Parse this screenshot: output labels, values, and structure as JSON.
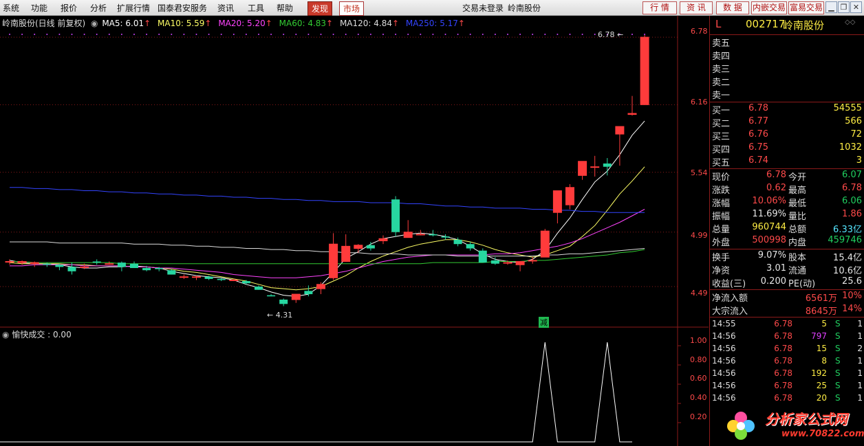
{
  "menubar": {
    "items": [
      "系统",
      "功能",
      "报价",
      "分析",
      "扩展行情",
      "国泰君安服务",
      "资讯",
      "工具",
      "帮助"
    ],
    "discover": "发现",
    "market": "市场",
    "status": "交易未登录",
    "stock_title": "岭南股份",
    "right_buttons": [
      "行 情",
      "资 讯",
      "数 据",
      "内嵌交易",
      "富易交易"
    ]
  },
  "chart_header": {
    "name": "岭南股份(日线 前复权)",
    "ma": [
      {
        "label": "MA5: 6.01",
        "color": "#ffffff"
      },
      {
        "label": "MA10: 5.59",
        "color": "#ffff66"
      },
      {
        "label": "MA20: 5.20",
        "color": "#ff44ff"
      },
      {
        "label": "MA60: 4.83",
        "color": "#33cc33"
      },
      {
        "label": "MA120: 4.84",
        "color": "#dddddd"
      },
      {
        "label": "MA250: 5.17",
        "color": "#3344ff"
      }
    ]
  },
  "price_axis": [
    "6.78",
    "6.16",
    "5.54",
    "4.99",
    "4.49"
  ],
  "annotations": {
    "high": "6.78",
    "low": "4.31",
    "marker": "减"
  },
  "indicator": {
    "title": "愉快成交 : 0.00",
    "axis": [
      "1.00",
      "0.80",
      "0.60",
      "0.40",
      "0.20"
    ]
  },
  "chart_data": {
    "type": "candlestick",
    "ylim": [
      4.25,
      6.85
    ],
    "candles": [
      [
        4.72,
        4.74,
        4.69,
        4.72
      ],
      [
        4.71,
        4.73,
        4.69,
        4.72
      ],
      [
        4.7,
        4.72,
        4.67,
        4.71
      ],
      [
        4.7,
        4.71,
        4.67,
        4.69
      ],
      [
        4.69,
        4.7,
        4.64,
        4.67
      ],
      [
        4.67,
        4.71,
        4.6,
        4.63
      ],
      [
        4.67,
        4.7,
        4.65,
        4.67
      ],
      [
        4.72,
        4.74,
        4.69,
        4.71
      ],
      [
        4.7,
        4.72,
        4.69,
        4.7
      ],
      [
        4.71,
        4.72,
        4.63,
        4.67
      ],
      [
        4.7,
        4.72,
        4.66,
        4.66
      ],
      [
        4.66,
        4.68,
        4.63,
        4.64
      ],
      [
        4.66,
        4.67,
        4.63,
        4.65
      ],
      [
        4.64,
        4.65,
        4.6,
        4.6
      ],
      [
        4.58,
        4.6,
        4.56,
        4.58
      ],
      [
        4.58,
        4.59,
        4.55,
        4.58
      ],
      [
        4.58,
        4.59,
        4.55,
        4.56
      ],
      [
        4.56,
        4.57,
        4.54,
        4.55
      ],
      [
        4.55,
        4.56,
        4.54,
        4.55
      ],
      [
        4.54,
        4.55,
        4.51,
        4.52
      ],
      [
        4.49,
        4.5,
        4.46,
        4.46
      ],
      [
        4.41,
        4.42,
        4.4,
        4.4
      ],
      [
        4.37,
        4.38,
        4.31,
        4.33
      ],
      [
        4.37,
        4.42,
        4.34,
        4.42
      ],
      [
        4.45,
        4.5,
        4.4,
        4.42
      ],
      [
        4.47,
        4.53,
        4.42,
        4.51
      ],
      [
        4.57,
        4.98,
        4.55,
        4.88
      ],
      [
        4.72,
        4.97,
        4.72,
        4.86
      ],
      [
        4.84,
        4.88,
        4.8,
        4.87
      ],
      [
        4.87,
        4.9,
        4.82,
        4.84
      ],
      [
        4.91,
        4.96,
        4.88,
        4.93
      ],
      [
        5.29,
        5.32,
        4.95,
        4.99
      ],
      [
        4.94,
        5.1,
        4.94,
        4.99
      ],
      [
        4.97,
        5.01,
        4.96,
        4.97
      ],
      [
        4.97,
        5.01,
        4.95,
        4.96
      ],
      [
        4.95,
        4.97,
        4.92,
        4.94
      ],
      [
        4.92,
        4.94,
        4.86,
        4.88
      ],
      [
        4.88,
        4.9,
        4.82,
        4.84
      ],
      [
        4.82,
        4.84,
        4.72,
        4.71
      ],
      [
        4.73,
        4.76,
        4.69,
        4.7
      ],
      [
        4.71,
        4.73,
        4.69,
        4.71
      ],
      [
        4.69,
        4.72,
        4.63,
        4.72
      ],
      [
        4.73,
        4.76,
        4.7,
        4.73
      ],
      [
        4.76,
        5.02,
        4.76,
        5.0
      ],
      [
        5.17,
        5.36,
        5.07,
        5.37
      ],
      [
        5.24,
        5.43,
        5.2,
        5.4
      ],
      [
        5.51,
        5.59,
        5.47,
        5.64
      ],
      [
        5.59,
        5.69,
        5.5,
        5.59
      ],
      [
        5.62,
        5.67,
        5.51,
        5.59
      ],
      [
        5.89,
        5.92,
        5.6,
        5.96
      ],
      [
        6.07,
        6.24,
        6.06,
        6.08
      ],
      [
        6.16,
        6.8,
        6.16,
        6.78
      ]
    ],
    "ma_series": [
      {
        "name": "MA5",
        "values": [
          4.73,
          4.71,
          4.7,
          4.7,
          4.69,
          4.67,
          4.66,
          4.66,
          4.67,
          4.67,
          4.68,
          4.67,
          4.66,
          4.63,
          4.61,
          4.59,
          4.58,
          4.57,
          4.55,
          4.51,
          4.48,
          4.44,
          4.41,
          4.4,
          4.42,
          4.5,
          4.62,
          4.75,
          4.81,
          4.88,
          4.93,
          4.95,
          4.97,
          4.98,
          4.97,
          4.95,
          4.92,
          4.86,
          4.79,
          4.74,
          4.72,
          4.71,
          4.74,
          4.82,
          4.98,
          5.12,
          5.29,
          5.45,
          5.55,
          5.7,
          5.88,
          6.01
        ]
      },
      {
        "name": "MA10",
        "values": [
          4.71,
          4.7,
          4.7,
          4.7,
          4.7,
          4.69,
          4.69,
          4.68,
          4.68,
          4.68,
          4.67,
          4.67,
          4.66,
          4.65,
          4.63,
          4.62,
          4.6,
          4.58,
          4.56,
          4.54,
          4.51,
          4.48,
          4.47,
          4.46,
          4.47,
          4.49,
          4.54,
          4.59,
          4.66,
          4.72,
          4.77,
          4.81,
          4.85,
          4.88,
          4.9,
          4.92,
          4.92,
          4.9,
          4.87,
          4.83,
          4.8,
          4.78,
          4.76,
          4.78,
          4.82,
          4.86,
          4.95,
          5.05,
          5.19,
          5.34,
          5.46,
          5.59
        ]
      },
      {
        "name": "MA20",
        "values": [
          4.68,
          4.68,
          4.69,
          4.69,
          4.69,
          4.69,
          4.68,
          4.68,
          4.68,
          4.68,
          4.67,
          4.67,
          4.66,
          4.66,
          4.65,
          4.64,
          4.63,
          4.62,
          4.6,
          4.59,
          4.58,
          4.57,
          4.57,
          4.57,
          4.58,
          4.59,
          4.61,
          4.63,
          4.66,
          4.69,
          4.72,
          4.74,
          4.76,
          4.77,
          4.78,
          4.78,
          4.78,
          4.78,
          4.78,
          4.79,
          4.79,
          4.8,
          4.82,
          4.84,
          4.86,
          4.89,
          4.93,
          4.98,
          5.03,
          5.08,
          5.14,
          5.2
        ]
      },
      {
        "name": "MA60",
        "values": [
          4.72,
          4.72,
          4.71,
          4.71,
          4.71,
          4.71,
          4.71,
          4.71,
          4.71,
          4.7,
          4.7,
          4.7,
          4.7,
          4.7,
          4.7,
          4.7,
          4.7,
          4.7,
          4.7,
          4.7,
          4.7,
          4.7,
          4.7,
          4.7,
          4.7,
          4.7,
          4.7,
          4.7,
          4.7,
          4.7,
          4.7,
          4.7,
          4.7,
          4.7,
          4.71,
          4.71,
          4.71,
          4.71,
          4.71,
          4.72,
          4.72,
          4.72,
          4.73,
          4.73,
          4.74,
          4.75,
          4.76,
          4.77,
          4.78,
          4.8,
          4.81,
          4.83
        ]
      },
      {
        "name": "MA120",
        "values": [
          4.9,
          4.9,
          4.9,
          4.9,
          4.89,
          4.89,
          4.89,
          4.89,
          4.89,
          4.89,
          4.88,
          4.88,
          4.88,
          4.87,
          4.87,
          4.86,
          4.86,
          4.85,
          4.85,
          4.84,
          4.84,
          4.83,
          4.83,
          4.82,
          4.82,
          4.81,
          4.81,
          4.8,
          4.8,
          4.79,
          4.79,
          4.79,
          4.78,
          4.78,
          4.78,
          4.78,
          4.77,
          4.77,
          4.77,
          4.77,
          4.77,
          4.77,
          4.77,
          4.78,
          4.78,
          4.79,
          4.79,
          4.8,
          4.81,
          4.82,
          4.83,
          4.84
        ]
      },
      {
        "name": "MA250",
        "values": [
          5.4,
          5.4,
          5.39,
          5.39,
          5.38,
          5.38,
          5.37,
          5.37,
          5.36,
          5.36,
          5.35,
          5.35,
          5.34,
          5.34,
          5.33,
          5.33,
          5.32,
          5.32,
          5.31,
          5.31,
          5.3,
          5.3,
          5.29,
          5.29,
          5.28,
          5.28,
          5.27,
          5.27,
          5.27,
          5.26,
          5.26,
          5.26,
          5.25,
          5.25,
          5.24,
          5.23,
          5.23,
          5.22,
          5.22,
          5.21,
          5.21,
          5.21,
          5.2,
          5.2,
          5.19,
          5.19,
          5.18,
          5.18,
          5.17,
          5.17,
          5.17,
          5.17
        ]
      }
    ],
    "indicator_values": [
      0,
      0,
      0,
      0,
      0,
      0,
      0,
      0,
      0,
      0,
      0,
      0,
      0,
      0,
      0,
      0,
      0,
      0,
      0,
      0,
      0,
      0,
      0,
      0,
      0,
      0,
      0,
      0,
      0,
      0,
      0,
      0,
      0,
      0,
      0,
      0,
      0,
      0,
      0,
      0,
      0,
      0,
      1,
      0,
      0,
      0,
      0,
      1,
      0,
      0
    ]
  },
  "panel": {
    "code": "002717",
    "name": "岭南股份",
    "l_mark": "L",
    "asks": [
      "卖五",
      "卖四",
      "卖三",
      "卖二",
      "卖一"
    ],
    "bids": [
      {
        "label": "买一",
        "price": "6.78",
        "vol": "54555"
      },
      {
        "label": "买二",
        "price": "6.77",
        "vol": "566"
      },
      {
        "label": "买三",
        "price": "6.76",
        "vol": "72"
      },
      {
        "label": "买四",
        "price": "6.75",
        "vol": "1032"
      },
      {
        "label": "买五",
        "price": "6.74",
        "vol": "3"
      }
    ],
    "quote": [
      {
        "l1": "现价",
        "v1": "6.78",
        "c1": "red",
        "l2": "今开",
        "v2": "6.07",
        "c2": "grn"
      },
      {
        "l1": "涨跌",
        "v1": "0.62",
        "c1": "red",
        "l2": "最高",
        "v2": "6.78",
        "c2": "red"
      },
      {
        "l1": "涨幅",
        "v1": "10.06%",
        "c1": "red",
        "l2": "最低",
        "v2": "6.06",
        "c2": "grn"
      },
      {
        "l1": "振幅",
        "v1": "11.69%",
        "c1": "wht",
        "l2": "量比",
        "v2": "1.86",
        "c2": "red"
      },
      {
        "l1": "总量",
        "v1": "960744",
        "c1": "ylw",
        "l2": "总额",
        "v2": "6.33亿",
        "c2": "cyn"
      },
      {
        "l1": "外盘",
        "v1": "500998",
        "c1": "red",
        "l2": "内盘",
        "v2": "459746",
        "c2": "grn"
      }
    ],
    "fund": [
      {
        "l1": "换手",
        "v1": "9.07%",
        "l2": "股本",
        "v2": "15.4亿"
      },
      {
        "l1": "净资",
        "v1": "3.01",
        "l2": "流通",
        "v2": "10.6亿"
      },
      {
        "l1": "收益(三)",
        "v1": "0.200",
        "l2": "PE(动)",
        "v2": "25.6"
      }
    ],
    "flow": [
      {
        "label": "净流入额",
        "value": "6561万",
        "pct": "10%"
      },
      {
        "label": "大宗流入",
        "value": "8645万",
        "pct": "14%"
      }
    ],
    "ticks": [
      {
        "t": "14:55",
        "p": "6.78",
        "v": "5",
        "vc": "ylw",
        "s": "S",
        "n": "1"
      },
      {
        "t": "14:56",
        "p": "6.78",
        "v": "797",
        "vc": "mag",
        "s": "S",
        "n": "1"
      },
      {
        "t": "14:56",
        "p": "6.78",
        "v": "15",
        "vc": "ylw",
        "s": "S",
        "n": "2"
      },
      {
        "t": "14:56",
        "p": "6.78",
        "v": "8",
        "vc": "ylw",
        "s": "S",
        "n": "1"
      },
      {
        "t": "14:56",
        "p": "6.78",
        "v": "192",
        "vc": "ylw",
        "s": "S",
        "n": "1"
      },
      {
        "t": "14:56",
        "p": "6.78",
        "v": "25",
        "vc": "ylw",
        "s": "S",
        "n": "1"
      },
      {
        "t": "14:56",
        "p": "6.78",
        "v": "20",
        "vc": "ylw",
        "s": "S",
        "n": "1"
      }
    ]
  },
  "watermark": {
    "text": "分析家公式网",
    "url": "www.70822.com"
  }
}
